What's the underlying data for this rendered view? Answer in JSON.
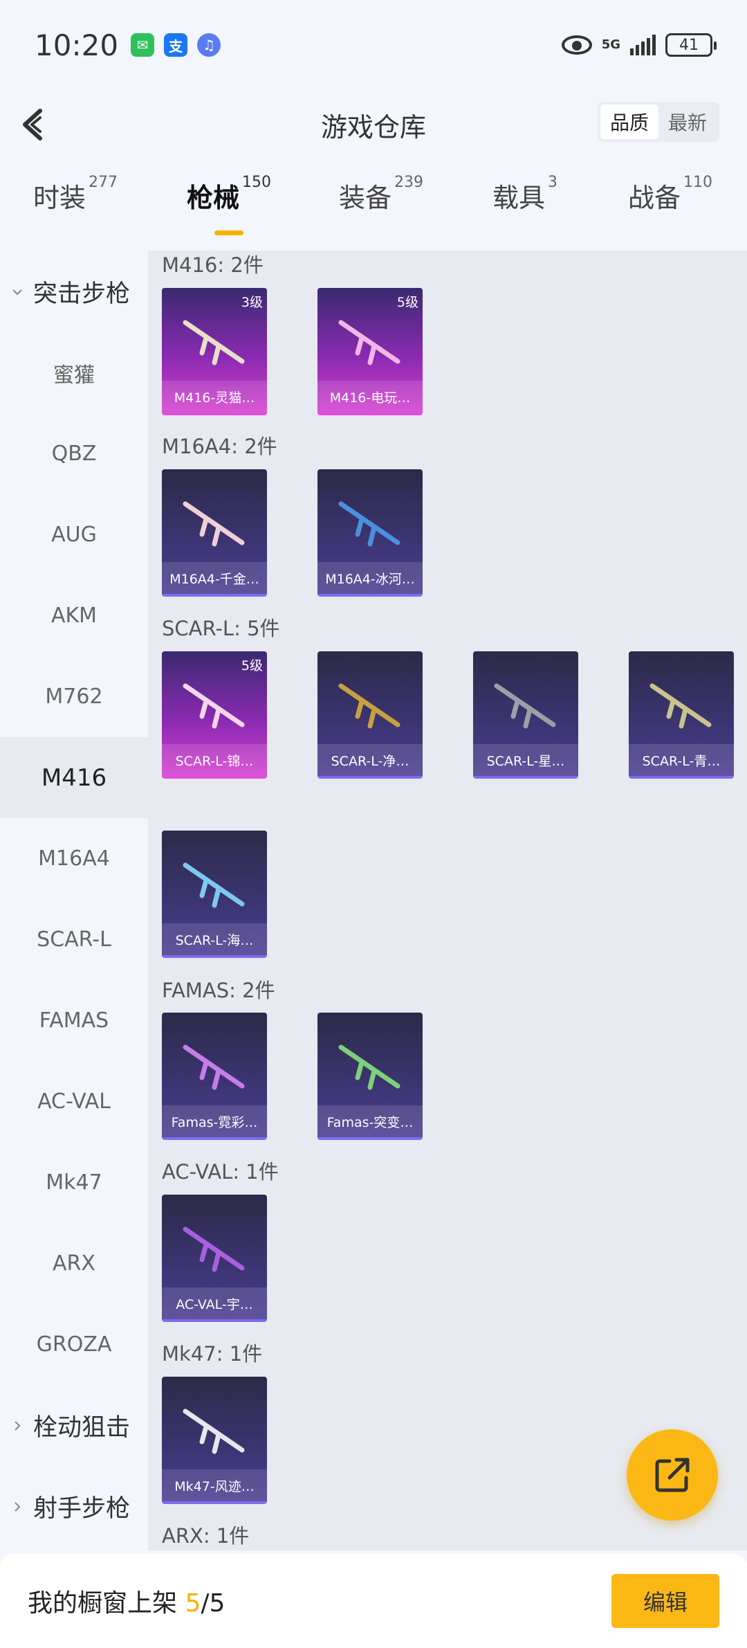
{
  "status_bar": {
    "time": "10:20",
    "app_icons": [
      {
        "name": "wechat-icon",
        "glyph": "✉"
      },
      {
        "name": "alipay-icon",
        "glyph": "支"
      },
      {
        "name": "music-icon",
        "glyph": "♫"
      }
    ],
    "network": "5G",
    "battery": "41"
  },
  "header": {
    "title": "游戏仓库",
    "sort_options": [
      "品质",
      "最新"
    ],
    "sort_selected": "品质"
  },
  "tabs": [
    {
      "label": "时装",
      "count": "277"
    },
    {
      "label": "枪械",
      "count": "150",
      "active": true
    },
    {
      "label": "装备",
      "count": "239"
    },
    {
      "label": "载具",
      "count": "3"
    },
    {
      "label": "战备",
      "count": "110"
    }
  ],
  "sidebar": {
    "groups": [
      "突击步枪",
      "栓动狙击",
      "射手步枪"
    ],
    "items": [
      "蜜獾",
      "QBZ",
      "AUG",
      "AKM",
      "M762",
      "M416",
      "M16A4",
      "SCAR-L",
      "FAMAS",
      "AC-VAL",
      "Mk47",
      "ARX",
      "GROZA"
    ],
    "active_item": "M416"
  },
  "content": {
    "labels": [
      "M416: 2件",
      "M16A4: 2件",
      "SCAR-L: 5件",
      "FAMAS: 2件",
      "AC-VAL: 1件",
      "Mk47: 1件",
      "ARX: 1件"
    ],
    "cards": [
      {
        "name": "M416-灵猫…",
        "level": "3级",
        "rarity": "purple"
      },
      {
        "name": "M416-电玩…",
        "level": "5级",
        "rarity": "purple"
      },
      {
        "name": "M16A4-千金…",
        "level": "",
        "rarity": "blue"
      },
      {
        "name": "M16A4-冰河…",
        "level": "",
        "rarity": "blue"
      },
      {
        "name": "SCAR-L-锦…",
        "level": "5级",
        "rarity": "purple"
      },
      {
        "name": "SCAR-L-净…",
        "level": "",
        "rarity": "blue"
      },
      {
        "name": "SCAR-L-星…",
        "level": "",
        "rarity": "blue"
      },
      {
        "name": "SCAR-L-青…",
        "level": "",
        "rarity": "blue"
      },
      {
        "name": "SCAR-L-海…",
        "level": "",
        "rarity": "blue"
      },
      {
        "name": "Famas-霓彩…",
        "level": "",
        "rarity": "blue"
      },
      {
        "name": "Famas-突变…",
        "level": "",
        "rarity": "blue"
      },
      {
        "name": "AC-VAL-宇…",
        "level": "",
        "rarity": "blue"
      },
      {
        "name": "Mk47-风迹…",
        "level": "",
        "rarity": "blue"
      }
    ]
  },
  "fab": {
    "icon": "share-icon"
  },
  "bottom_bar": {
    "shelf_label": "我的橱窗上架",
    "shelf_current": "5",
    "shelf_separator": "/",
    "shelf_total": "5",
    "edit_label": "编辑"
  },
  "colors": {
    "accent": "#fbb814",
    "purple_rarity": "#d43fcf",
    "blue_rarity": "#4a3c90"
  }
}
